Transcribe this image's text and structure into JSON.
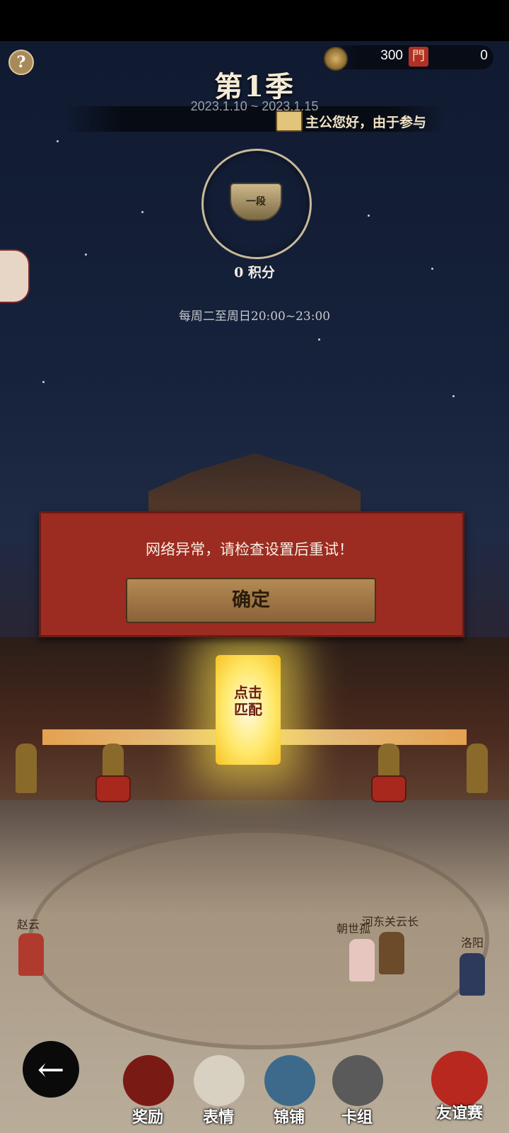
{
  "header": {
    "coins": "300",
    "gate_count": "0",
    "gate_glyph": "門",
    "help_glyph": "?"
  },
  "season": {
    "title": "第1季",
    "date_range": "2023.1.10 ~ 2023.1.15",
    "notice": "主公您好，由于参与"
  },
  "rank": {
    "tier_label": "一段",
    "score": "0 积分",
    "schedule": "每周二至周日20:00~23:00"
  },
  "dialog": {
    "message": "网络异常，请检查设置后重试！",
    "confirm_label": "确定"
  },
  "portal": {
    "label_line1": "点击",
    "label_line2": "匹配"
  },
  "heroes": {
    "left": "赵云",
    "mid_a": "朝世孤",
    "mid_b": "河东关云长",
    "right": "洛阳"
  },
  "bottom_nav": {
    "rewards": "奖励",
    "emotes": "表情",
    "shop": "锦铺",
    "deck": "卡组",
    "friendly": "友谊赛",
    "back_glyph": "←"
  }
}
